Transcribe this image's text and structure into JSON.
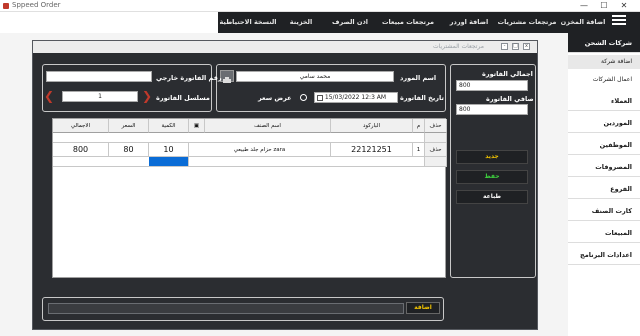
{
  "window": {
    "title": "Sppeed Order",
    "minimize": "—",
    "maximize": "☐",
    "close": "✕"
  },
  "menu": [
    "اضافة المخزن",
    "مرتجعات مشتريات",
    "اضافة اوردر",
    "مرتجعات مبيعات",
    "اذن الصرف",
    "الخزينة",
    "النسخة الاحتياطية"
  ],
  "sidebar": {
    "section": "شركات الشحن",
    "sub_items": [
      "اضافة شركة",
      "اعمال الشركات"
    ],
    "items": [
      "العملاء",
      "الموردين",
      "الموظفين",
      "المصروفات",
      "الفروع",
      "كارت الصنف",
      "المبيعات",
      "اعدادات البرنامج"
    ]
  },
  "dialog": {
    "caption": "مرتجعات المشتريات",
    "supplier_label": "اسم المورد",
    "supplier_value": "محمد سامي",
    "invoice_date_label": "تاريخ الفاتورة",
    "invoice_date_value": "15/03/2022 12:3 AM",
    "show_price_label": "عرض سعر",
    "external_invoice_label": "رقم الفاتورة خارجي",
    "external_invoice_value": "",
    "invoice_serial_label": "مسلسل الفاتورة",
    "invoice_serial_value": "1",
    "total_invoice_label": "اجمالي الفاتورة",
    "total_invoice_value": "800",
    "net_invoice_label": "صافي الفاتورة",
    "net_invoice_value": "800",
    "grid": {
      "headers": [
        "حذف",
        "م",
        "الباركود",
        "اسم الصنف",
        "الكمية",
        "السعر",
        "الاجمالي"
      ],
      "rows": [
        {
          "delete": "حذف",
          "index": "1",
          "barcode": "22121251",
          "name": "حزام جلد طبيعي zara",
          "qty": "10",
          "price": "80",
          "total": "800"
        }
      ]
    },
    "buttons": {
      "new": "جديد",
      "save": "حفظ",
      "print": "طباعة",
      "add": "اضافة"
    },
    "colors": {
      "new": "#f2c400",
      "save": "#3ecf3e",
      "print": "#ffffff",
      "arrows": "#c0392b"
    }
  }
}
